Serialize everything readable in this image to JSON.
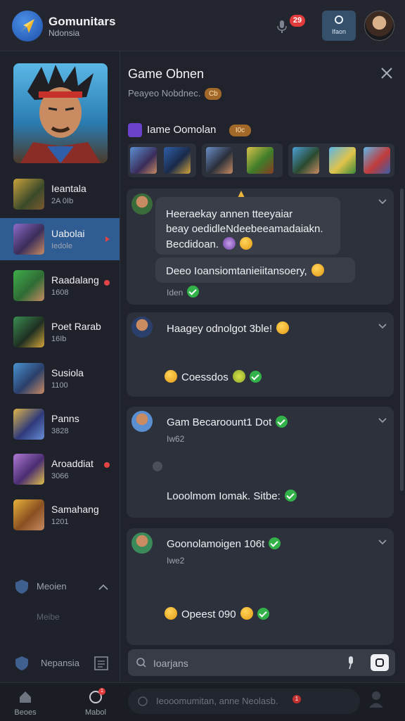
{
  "header": {
    "app_title": "Gomunitars",
    "app_subtitle": "Ndonsia",
    "notification_count": "29",
    "search_button_label": "Ifaon"
  },
  "sidebar": {
    "items": [
      {
        "name": "Ieantala",
        "count": "2A 0Ib"
      },
      {
        "name": "Uabolai",
        "count": "Iedole"
      },
      {
        "name": "Raadalang",
        "count": "1608"
      },
      {
        "name": "Poet Rarab",
        "count": "16Ib"
      },
      {
        "name": "Susiola",
        "count": "1100"
      },
      {
        "name": "Panns",
        "count": "3828"
      },
      {
        "name": "Aroaddiat",
        "count": "3066"
      },
      {
        "name": "Samahang",
        "count": "1201"
      }
    ],
    "footer_section": {
      "label": "Meoien",
      "sub": "Meibe"
    },
    "footer_bottom": {
      "label": "Nepansia"
    }
  },
  "panel": {
    "title": "Game Obnen",
    "subtitle": "Peayeo Nobdnec.",
    "subtitle_badge": "Cb",
    "section_title": "Iame Oomolan",
    "section_pill": "I0c",
    "messages": [
      {
        "lines": [
          "Heeraekay annen tteeyaiar",
          "beay oedidleNdeebeeamadaiakn.",
          "Becdidoan."
        ]
      },
      {
        "lines": [
          "Deeo Ioansiomtanieiitansoery,"
        ],
        "meta": "Iden"
      },
      {
        "title": "Haagey odnolgot 3ble!",
        "footer": "Coessdos"
      },
      {
        "title": "Gam Becaroount1 Dot",
        "meta": "Iw62",
        "footer": "Looolmom Iomak. Sitbe:"
      },
      {
        "title": "Goonolamoigen 106t",
        "meta": "Iwe2",
        "footer": "Opeest 090"
      }
    ]
  },
  "search": {
    "placeholder": "Ioarjans"
  },
  "bottom_nav": {
    "home_label": "Beoes",
    "messages_label": "Mabol",
    "messages_badge": "1",
    "composer_text": "Ieooomumitan, anne Neolasb.",
    "composer_badge": "1"
  },
  "colors": {
    "accent": "#2f5c92",
    "check_green": "#33b24a",
    "alert_red": "#e23b3b",
    "pill_orange": "#a1682a"
  },
  "icons": [
    "logo-icon",
    "mic-icon",
    "search-icon",
    "close-icon",
    "chevron-down-icon",
    "chevron-up-icon",
    "shield-icon",
    "home-icon",
    "chat-icon",
    "send-icon",
    "profile-icon"
  ]
}
